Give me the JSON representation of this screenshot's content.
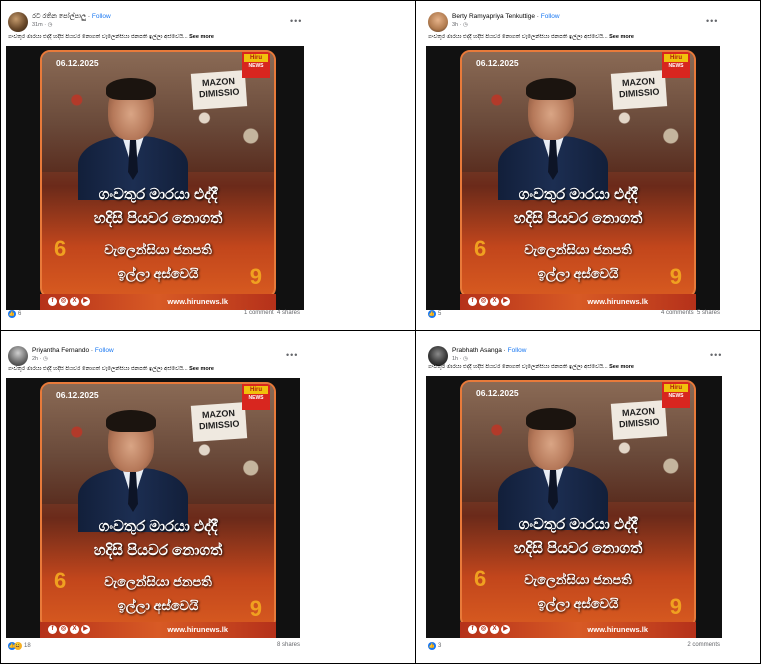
{
  "posts": [
    {
      "author": "රට රතින පෝල්පාලු",
      "follow": "Follow",
      "time": "31m · ◷",
      "menu": "•••",
      "caption": "ගංවතුර මාරයා එද්දී හදිසි පියවර නොගත් වැලෙන්සියා ජනපති ඉල්ලා අස්වෙයි...",
      "see_more": "See more",
      "reactions": "6",
      "comments": "1 comment",
      "shares": "4 shares"
    },
    {
      "author": "Berty Ramyapriya Tenkuttige",
      "follow": "Follow",
      "time": "3h · ◷",
      "menu": "•••",
      "caption": "ගංවතුර මාරයා එද්දී හදිසි පියවර නොගත් වැලෙන්සියා ජනපති ඉල්ලා අස්වෙයි...",
      "see_more": "See more",
      "reactions": "5",
      "comments": "4 comments",
      "shares": "5 shares"
    },
    {
      "author": "Priyantha Fernando",
      "follow": "Follow",
      "time": "2h · ◷",
      "menu": "•••",
      "caption": "ගංවතුර මාරයා එද්දී හදිසි පියවර නොගත් වැලෙන්සියා ජනපති ඉල්ලා අස්වෙයි...",
      "see_more": "See more",
      "reactions": "18",
      "comments": "",
      "shares": "8 shares"
    },
    {
      "author": "Prabhath Asanga",
      "follow": "Follow",
      "time": "1h · ◷",
      "menu": "•••",
      "caption": "ගංවතුර මාරයා එද්දී හදිසි පියවර නොගත් වැලෙන්සියා ජනපති ඉල්ලා අස්වෙයි...",
      "see_more": "See more",
      "reactions": "3",
      "comments": "2 comments",
      "shares": ""
    }
  ],
  "card": {
    "date": "06.12.2025",
    "logo_top": "Hiru",
    "logo_bottom": "NEWS",
    "banner": "MAZON DIMISSIO",
    "line1": "ගංවතුර මාරයා එද්දී",
    "line2": "හදිසි පියවර නොගත්",
    "line3": "වැලෙන්සියා ජනපති",
    "line4": "ඉල්ලා අස්වෙයි",
    "quote_open": "6",
    "quote_close": "9",
    "site": "www.hirunews.lk",
    "social_icons": [
      "facebook-icon",
      "instagram-icon",
      "x-icon",
      "youtube-icon"
    ],
    "social_glyphs": [
      "f",
      "◎",
      "X",
      "▶"
    ]
  },
  "colors": {
    "follow": "#1877f2",
    "card_border": "#e87a3a",
    "footer": "#b5311a"
  }
}
